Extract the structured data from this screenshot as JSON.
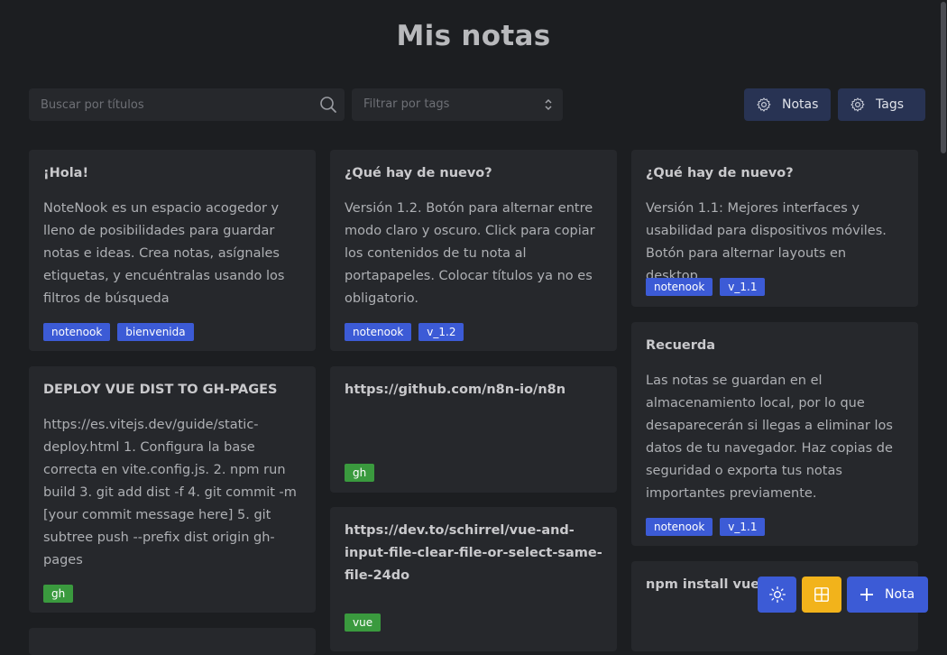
{
  "header": {
    "title": "Mis notas"
  },
  "search": {
    "placeholder": "Buscar por títulos",
    "value": ""
  },
  "tag_filter": {
    "placeholder": "Filtrar por tags"
  },
  "top_buttons": {
    "notes_label": "Notas",
    "tags_label": "Tags"
  },
  "notes": [
    {
      "title": "¡Hola!",
      "body": "NoteNook es un espacio acogedor y lleno de posibilidades para guardar notas e ideas. Crea notas, asígnales etiquetas, y encuéntralas usando los filtros de búsqueda",
      "tags": [
        "notenook",
        "bienvenida"
      ]
    },
    {
      "title": "DEPLOY VUE DIST TO GH-PAGES",
      "body": "https://es.vitejs.dev/guide/static-deploy.html 1. Configura la base correcta en vite.config.js. 2. npm run build 3. git add dist -f 4. git commit -m [your commit message here] 5. git subtree push --prefix dist origin gh-pages",
      "tags": [
        "gh"
      ]
    },
    {
      "title": "¿Qué hay de nuevo?",
      "body": "Versión 1.2. Botón para alternar entre modo claro y oscuro. Click para copiar los contenidos de tu nota al portapapeles. Colocar títulos ya no es obligatorio.",
      "tags": [
        "notenook",
        "v_1.2"
      ]
    },
    {
      "title": "https://github.com/n8n-io/n8n",
      "body": "",
      "tags": [
        "gh"
      ]
    },
    {
      "title": "https://dev.to/schirrel/vue-and-input-file-clear-file-or-select-same-file-24do",
      "body": "",
      "tags": [
        "vue"
      ]
    },
    {
      "title": "¿Qué hay de nuevo?",
      "body": "Versión 1.1: Mejores interfaces y usabilidad para dispositivos móviles. Botón para alternar layouts en desktop.",
      "tags": [
        "notenook",
        "v_1.1"
      ]
    },
    {
      "title": "Recuerda",
      "body": "Las notas se guardan en el almacenamiento local, por lo que desaparecerán si llegas a eliminar los datos de tu navegador. Haz copias de seguridad o exporta tus notas importantes previamente.",
      "tags": [
        "notenook",
        "v_1.1"
      ]
    },
    {
      "title": "npm install vue-",
      "body": "",
      "tags": []
    }
  ],
  "fab": {
    "theme_icon": "sun-icon",
    "layout_icon": "grid-icon",
    "new_note_label": "Nota"
  },
  "colors": {
    "background": "#1c1e21",
    "card": "#26282c",
    "tag_blue": "#3c5bd6",
    "tag_green": "#3a9a3e",
    "accent": "#3c5bd6",
    "layout_button": "#f2b31b",
    "top_button": "#283353"
  }
}
